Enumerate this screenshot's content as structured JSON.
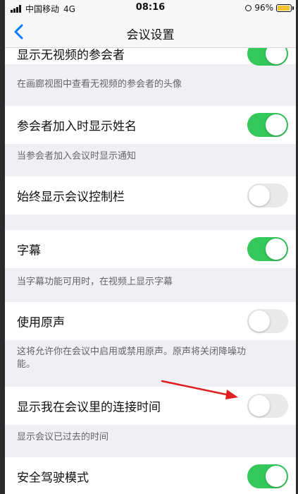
{
  "status_bar": {
    "carrier": "中国移动",
    "network": "4G",
    "time": "08:16",
    "battery": "96%",
    "battery_level": 0.96
  },
  "nav": {
    "back_icon": "chevron-left-icon",
    "title": "会议设置"
  },
  "settings": [
    {
      "label": "显示无视频的参会者",
      "on": true,
      "desc": "在画廊视图中查看无视频的参会者的头像"
    },
    {
      "label": "参会者加入时显示姓名",
      "on": true,
      "desc": "当参会者加入会议时显示通知"
    },
    {
      "label": "始终显示会议控制栏",
      "on": false,
      "desc": ""
    },
    {
      "label": "字幕",
      "on": true,
      "desc": "当字幕功能可用时，在视频上显示字幕"
    },
    {
      "label": "使用原声",
      "on": false,
      "desc": "这将允许你在会议中启用或禁用原声。原声将关闭降噪功能。"
    },
    {
      "label": "显示我在会议里的连接时间",
      "on": false,
      "desc": "显示会议已过去的时间"
    },
    {
      "label": "安全驾驶模式",
      "on": true,
      "desc": ""
    }
  ],
  "colors": {
    "accent": "#007aff",
    "toggle_on": "#34c759",
    "toggle_off": "#e9e9ea",
    "annotation_arrow": "#e02020"
  }
}
